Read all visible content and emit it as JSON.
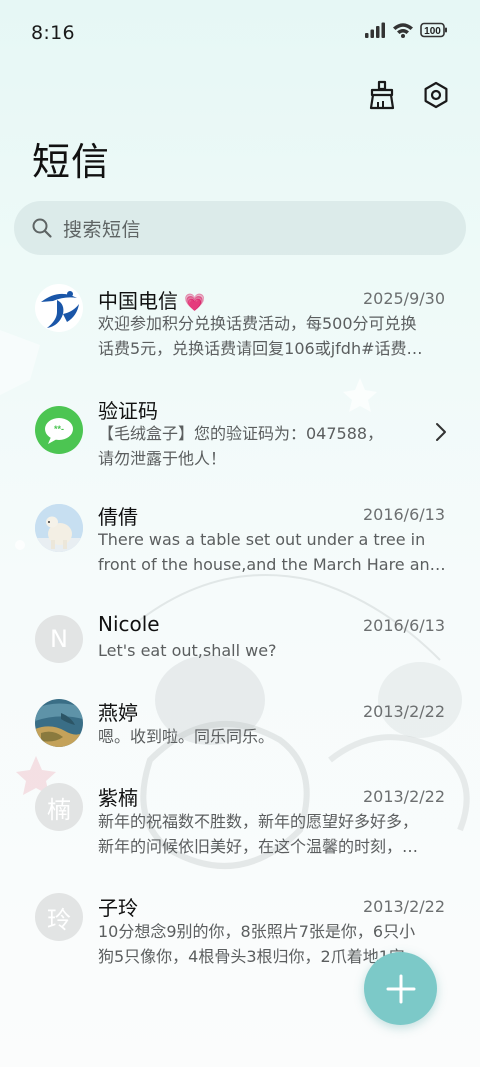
{
  "status_bar": {
    "time": "8:16",
    "battery": "100"
  },
  "header": {
    "title": "短信",
    "actions": [
      {
        "icon": "broom-icon"
      },
      {
        "icon": "settings-icon"
      }
    ]
  },
  "search": {
    "placeholder": "搜索短信"
  },
  "conversations": [
    {
      "name": "中国电信",
      "badge": "💗",
      "date": "2025/9/30",
      "lines": [
        "欢迎参加积分兑换话费活动，每500分可兑换",
        "话费5元，兑换话费请回复106或jfdh#话费…"
      ],
      "avatar": "china-telecom-logo"
    },
    {
      "name": "验证码",
      "date": "",
      "lines": [
        "【毛绒盒子】您的验证码为：047588，",
        "请勿泄露于他人！"
      ],
      "avatar": "message-bubble-icon"
    },
    {
      "name": "倩倩",
      "date": "2016/6/13",
      "lines": [
        "There was a table set out under a tree in",
        "front of the house,and the March Hare an…"
      ],
      "avatar": "polar-bear-photo"
    },
    {
      "name": "Nicole",
      "date": "2016/6/13",
      "lines": [
        "Let's eat out,shall we?"
      ],
      "avatar_letter": "N"
    },
    {
      "name": "燕婷",
      "date": "2013/2/22",
      "lines": [
        "嗯。收到啦。同乐同乐。"
      ],
      "avatar": "landscape-photo"
    },
    {
      "name": "紫楠",
      "date": "2013/2/22",
      "lines": [
        "新年的祝福数不胜数，新年的愿望好多好多，",
        "新年的问候依旧美好，在这个温馨的时刻，…"
      ],
      "avatar_letter": "楠"
    },
    {
      "name": "子玲",
      "date": "2013/2/22",
      "lines": [
        "10分想念9别的你，8张照片7张是你，6只小",
        "狗5只像你，4根骨头3根归你，2爪着地1安…"
      ],
      "avatar_letter": "玲"
    }
  ],
  "fab": {
    "icon": "plus-icon"
  },
  "colors": {
    "accent": "#7cc9c8",
    "telecom_blue": "#1a56a8",
    "message_green": "#4cc552"
  }
}
